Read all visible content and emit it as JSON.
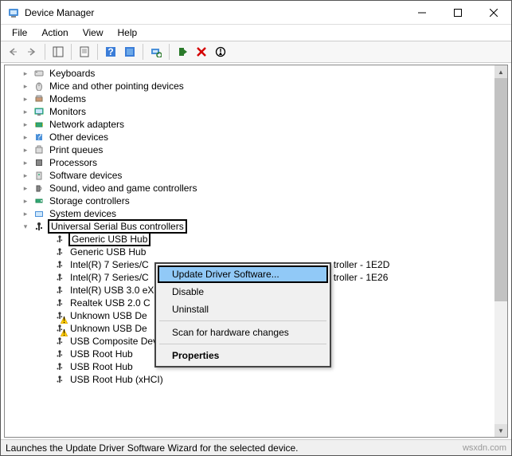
{
  "title": "Device Manager",
  "menu": {
    "file": "File",
    "action": "Action",
    "view": "View",
    "help": "Help"
  },
  "categories": [
    {
      "label": "Keyboards"
    },
    {
      "label": "Mice and other pointing devices"
    },
    {
      "label": "Modems"
    },
    {
      "label": "Monitors"
    },
    {
      "label": "Network adapters"
    },
    {
      "label": "Other devices"
    },
    {
      "label": "Print queues"
    },
    {
      "label": "Processors"
    },
    {
      "label": "Software devices"
    },
    {
      "label": "Sound, video and game controllers"
    },
    {
      "label": "Storage controllers"
    },
    {
      "label": "System devices"
    }
  ],
  "usb": {
    "category": "Universal Serial Bus controllers",
    "items": [
      {
        "label": "Generic USB Hub",
        "selected": true
      },
      {
        "label": "Generic USB Hub"
      },
      {
        "label": "Intel(R) 7 Series/C",
        "suffix": "troller - 1E2D"
      },
      {
        "label": "Intel(R) 7 Series/C",
        "suffix": "troller - 1E26"
      },
      {
        "label": "Intel(R) USB 3.0 eX"
      },
      {
        "label": "Realtek USB 2.0 C"
      },
      {
        "label": "Unknown USB De",
        "warn": true
      },
      {
        "label": "Unknown USB De",
        "warn": true
      },
      {
        "label": "USB Composite Device"
      },
      {
        "label": "USB Root Hub"
      },
      {
        "label": "USB Root Hub"
      },
      {
        "label": "USB Root Hub (xHCI)"
      }
    ]
  },
  "context": {
    "update": "Update Driver Software...",
    "disable": "Disable",
    "uninstall": "Uninstall",
    "scan": "Scan for hardware changes",
    "properties": "Properties"
  },
  "status": "Launches the Update Driver Software Wizard for the selected device.",
  "watermark": "wsxdn.com"
}
